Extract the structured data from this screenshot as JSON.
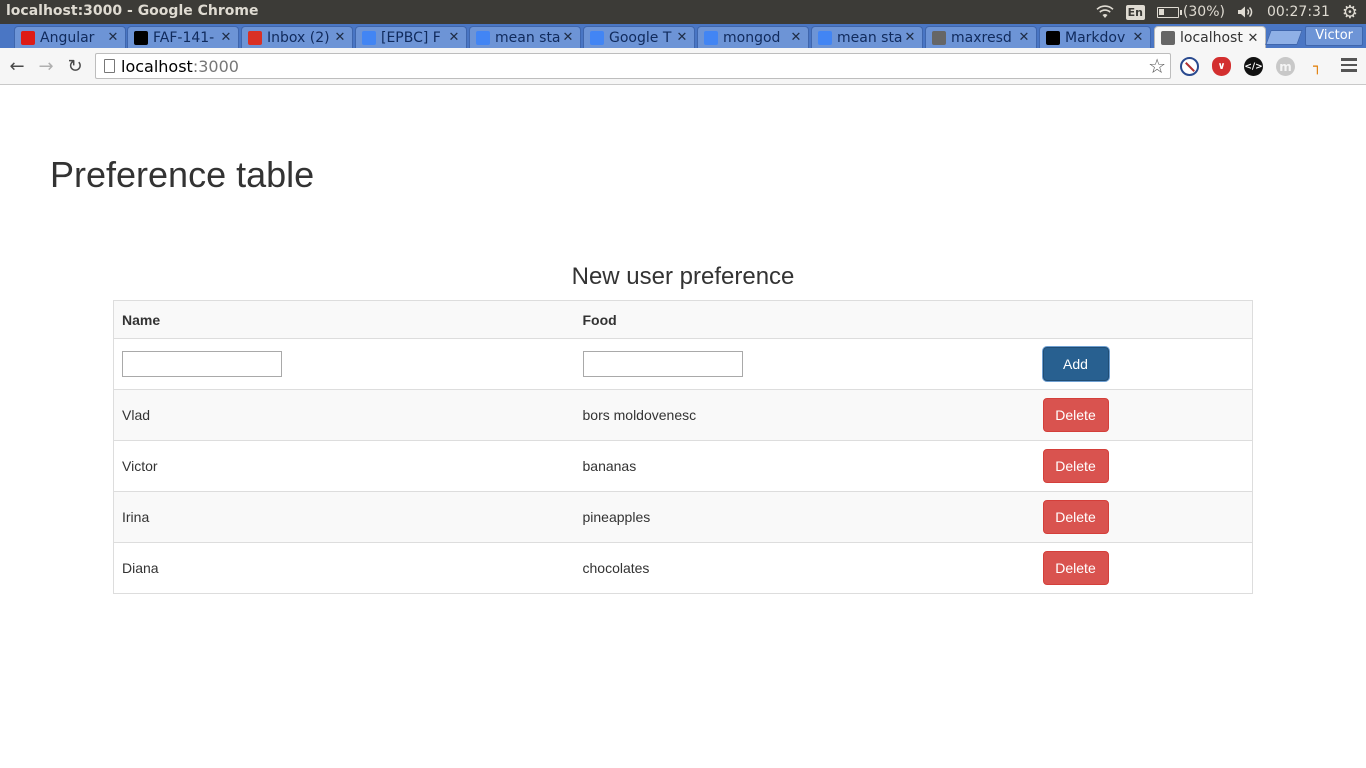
{
  "os": {
    "window_title": "localhost:3000 - Google Chrome",
    "lang": "En",
    "battery": "(30%)",
    "battery_level": 0.3,
    "clock": "00:27:31"
  },
  "browser": {
    "tabs": [
      {
        "label": "Angular",
        "icon": "angular-icon",
        "color": "#dd1b16"
      },
      {
        "label": "FAF-141-",
        "icon": "github-icon",
        "color": "#000000"
      },
      {
        "label": "Inbox (2)",
        "icon": "gmail-icon",
        "color": "#d93025"
      },
      {
        "label": "[EPBC] F",
        "icon": "docs-icon",
        "color": "#4285f4"
      },
      {
        "label": "mean sta",
        "icon": "google-icon",
        "color": "#4285f4"
      },
      {
        "label": "Google T",
        "icon": "google-translate-icon",
        "color": "#4285f4"
      },
      {
        "label": "mongod",
        "icon": "google-icon",
        "color": "#4285f4"
      },
      {
        "label": "mean sta",
        "icon": "google-icon",
        "color": "#4285f4"
      },
      {
        "label": "maxresd",
        "icon": "page-icon",
        "color": "#666666"
      },
      {
        "label": "Markdov",
        "icon": "github-icon",
        "color": "#000000"
      },
      {
        "label": "localhost",
        "icon": "page-icon",
        "color": "#666666",
        "active": true
      }
    ],
    "profile_name": "Victor",
    "url_host": "localhost",
    "url_port": ":3000"
  },
  "page": {
    "title": "Preference table",
    "table_caption": "New user preference",
    "columns": {
      "name": "Name",
      "food": "Food"
    },
    "inputs": {
      "name_value": "",
      "food_value": ""
    },
    "add_label": "Add",
    "delete_label": "Delete",
    "rows": [
      {
        "name": "Vlad",
        "food": "bors moldovenesc"
      },
      {
        "name": "Victor",
        "food": "bananas"
      },
      {
        "name": "Irina",
        "food": "pineapples"
      },
      {
        "name": "Diana",
        "food": "chocolates"
      }
    ]
  }
}
